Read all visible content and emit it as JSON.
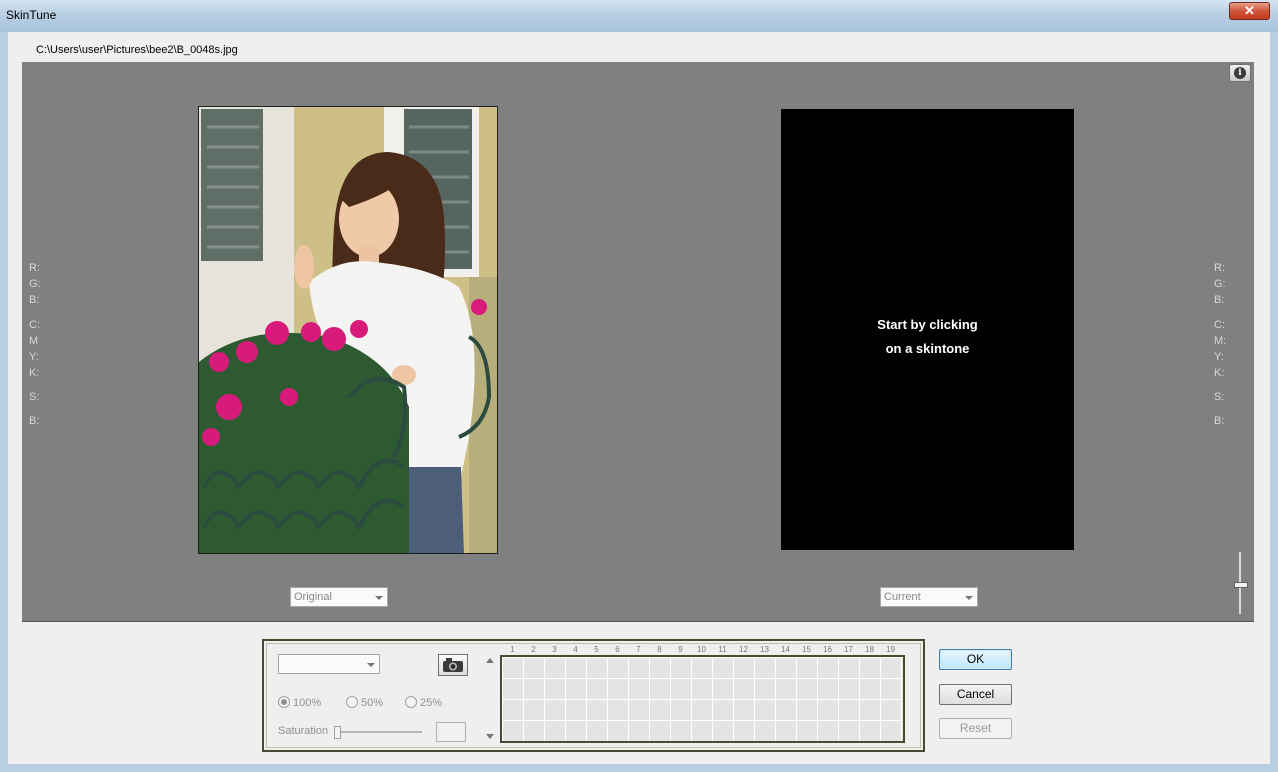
{
  "window": {
    "title": "SkinTune",
    "close_glyph": "✕"
  },
  "file_path": "C:\\Users\\user\\Pictures\\bee2\\B_0048s.jpg",
  "left_readout": [
    "R:",
    "G:",
    "B:",
    "C:",
    "M",
    "Y:",
    "K:",
    "S:",
    "B:"
  ],
  "right_readout": [
    "R:",
    "G:",
    "B:",
    "C:",
    "M:",
    "Y:",
    "K:",
    "S:",
    "B:"
  ],
  "result_message": {
    "line1": "Start by clicking",
    "line2": "on a skintone"
  },
  "left_view_select": "Original",
  "right_view_select": "Current",
  "panel": {
    "preset_select": "",
    "radios": [
      {
        "label": "100%",
        "selected": true
      },
      {
        "label": "50%",
        "selected": false
      },
      {
        "label": "25%",
        "selected": false
      }
    ],
    "saturation_label": "Saturation",
    "grid_columns": [
      "1",
      "2",
      "3",
      "4",
      "5",
      "6",
      "7",
      "8",
      "9",
      "10",
      "11",
      "12",
      "13",
      "14",
      "15",
      "16",
      "17",
      "18",
      "19"
    ]
  },
  "buttons": {
    "ok": "OK",
    "cancel": "Cancel",
    "reset": "Reset"
  },
  "icons": {
    "info": "info-icon",
    "camera": "camera-icon"
  }
}
